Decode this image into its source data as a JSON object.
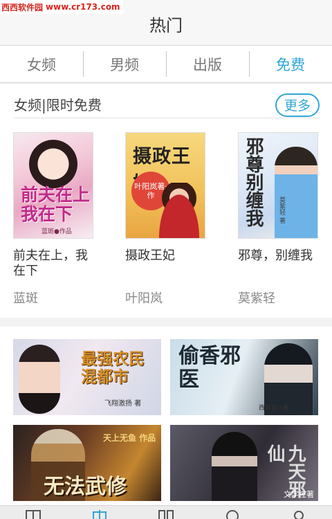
{
  "watermark": {
    "logo": "西西软件园",
    "url": "www.cr173.com"
  },
  "header": {
    "title": "热门"
  },
  "tabs": [
    {
      "label": "女频",
      "active": false
    },
    {
      "label": "男频",
      "active": false
    },
    {
      "label": "出版",
      "active": false
    },
    {
      "label": "免费",
      "active": true
    }
  ],
  "section": {
    "title": "女频|限时免费",
    "more_label": "更多",
    "books": [
      {
        "title": "前夫在上，我在下",
        "author": "蓝斑",
        "cover_text": "前夫在上我在下",
        "cover_sub": "蓝斑●作品"
      },
      {
        "title": "摄政王妃",
        "author": "叶阳岚",
        "cover_text": "摄政王妃",
        "cover_sub": "叶阳岚著·作"
      },
      {
        "title": "邪尊，别缠我",
        "author": "莫紫轻",
        "cover_text": "邪尊别缠我",
        "cover_sub": "莫紫轻 著"
      }
    ]
  },
  "banners": [
    {
      "cover_text": "最强农民混都市",
      "cover_sub": "飞翔激扬 著"
    },
    {
      "cover_text": "偷香邪医",
      "cover_sub": "西慕容◎著"
    },
    {
      "cover_text": "无法武修",
      "cover_sub": "天上无鱼 作品"
    },
    {
      "cover_text": "九天邪仙",
      "cover_sub": "文字控著"
    }
  ],
  "colors": {
    "accent": "#2fa6d8",
    "tab_inactive": "#777777",
    "author_gray": "#888888"
  },
  "bottom_nav_icons": [
    "bookshelf-icon",
    "gift-icon",
    "grid-icon",
    "search-icon",
    "user-icon"
  ]
}
